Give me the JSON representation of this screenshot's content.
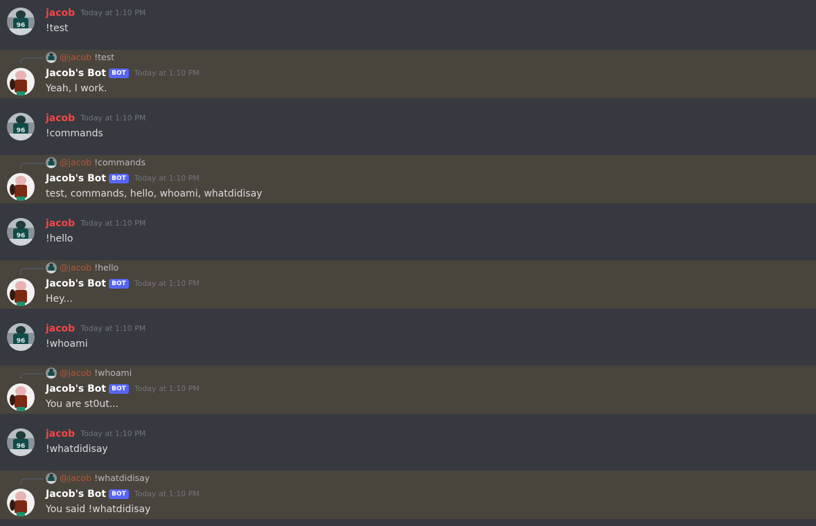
{
  "user": {
    "name": "jacob",
    "mention": "@jacob",
    "avatar_icon": "football-player-avatar-icon",
    "name_color": "#f04747"
  },
  "bot": {
    "name": "Jacob's Bot",
    "tag": "BOT",
    "avatar_icon": "character-avatar-icon",
    "tag_color": "#5865f2"
  },
  "colors": {
    "background": "#36393f",
    "bot_highlight": "#49443c",
    "timestamp": "#72767d",
    "text": "#dcddde"
  },
  "messages": [
    {
      "author": "jacob",
      "timestamp": "Today at 1:10 PM",
      "content": "!test"
    },
    {
      "author": "Jacob's Bot",
      "reply_to": "!test",
      "timestamp": "Today at 1:10 PM",
      "content": "Yeah, I work."
    },
    {
      "author": "jacob",
      "timestamp": "Today at 1:10 PM",
      "content": "!commands"
    },
    {
      "author": "Jacob's Bot",
      "reply_to": "!commands",
      "timestamp": "Today at 1:10 PM",
      "content": "test, commands, hello, whoami, whatdidisay"
    },
    {
      "author": "jacob",
      "timestamp": "Today at 1:10 PM",
      "content": "!hello"
    },
    {
      "author": "Jacob's Bot",
      "reply_to": "!hello",
      "timestamp": "Today at 1:10 PM",
      "content": "Hey..."
    },
    {
      "author": "jacob",
      "timestamp": "Today at 1:10 PM",
      "content": "!whoami"
    },
    {
      "author": "Jacob's Bot",
      "reply_to": "!whoami",
      "timestamp": "Today at 1:10 PM",
      "content": "You are st0ut..."
    },
    {
      "author": "jacob",
      "timestamp": "Today at 1:10 PM",
      "content": "!whatdidisay"
    },
    {
      "author": "Jacob's Bot",
      "reply_to": "!whatdidisay",
      "timestamp": "Today at 1:10 PM",
      "content": "You said !whatdidisay"
    }
  ]
}
